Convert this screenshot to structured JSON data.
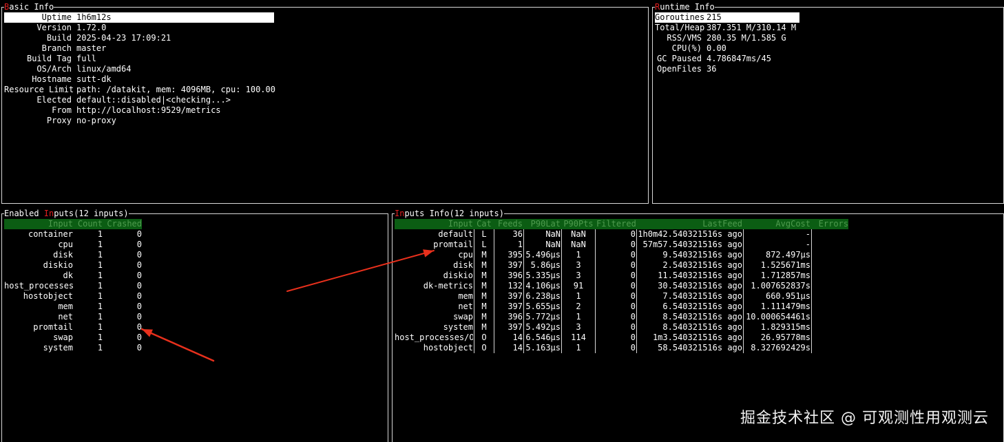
{
  "basic_info": {
    "title_hotkey": "B",
    "title_rest": "asic Info",
    "fields": [
      {
        "key": "Uptime",
        "value": "1h6m12s"
      },
      {
        "key": "Version",
        "value": "1.72.0"
      },
      {
        "key": "Build",
        "value": "2025-04-23 17:09:21"
      },
      {
        "key": "Branch",
        "value": "master"
      },
      {
        "key": "Build Tag",
        "value": "full"
      },
      {
        "key": "OS/Arch",
        "value": "linux/amd64"
      },
      {
        "key": "Hostname",
        "value": "sutt-dk"
      },
      {
        "key": "Resource Limit",
        "value": "path: /datakit, mem: 4096MB, cpu: 100.00"
      },
      {
        "key": "Elected",
        "value": "default::disabled|<checking...>"
      },
      {
        "key": "From",
        "value": "http://localhost:9529/metrics"
      },
      {
        "key": "Proxy",
        "value": "no-proxy"
      }
    ]
  },
  "runtime_info": {
    "title_hotkey": "R",
    "title_rest": "untime Info",
    "fields": [
      {
        "key": "Goroutines",
        "value": "215"
      },
      {
        "key": "Total/Heap",
        "value": "387.351 M/310.14 M"
      },
      {
        "key": "RSS/VMS",
        "value": "280.35 M/1.585 G"
      },
      {
        "key": "CPU(%)",
        "value": "0.00"
      },
      {
        "key": "GC Paused",
        "value": "4.786847ms/45"
      },
      {
        "key": "OpenFiles",
        "value": "36"
      }
    ]
  },
  "enabled_inputs": {
    "title_pre": "Enabled ",
    "title_hotkey": "In",
    "title_rest": "puts(12 inputs)",
    "columns": [
      "Input",
      "Count",
      "Crashed"
    ],
    "rows": [
      [
        "container",
        "1",
        "0"
      ],
      [
        "cpu",
        "1",
        "0"
      ],
      [
        "disk",
        "1",
        "0"
      ],
      [
        "diskio",
        "1",
        "0"
      ],
      [
        "dk",
        "1",
        "0"
      ],
      [
        "host_processes",
        "1",
        "0"
      ],
      [
        "hostobject",
        "1",
        "0"
      ],
      [
        "mem",
        "1",
        "0"
      ],
      [
        "net",
        "1",
        "0"
      ],
      [
        "promtail",
        "1",
        "0"
      ],
      [
        "swap",
        "1",
        "0"
      ],
      [
        "system",
        "1",
        "0"
      ]
    ]
  },
  "inputs_info": {
    "title_hotkey": "In",
    "title_rest": "puts Info(12 inputs)",
    "columns": [
      "Input",
      "Cat",
      "Feeds",
      "P90Lat",
      "P90Pts",
      "Filtered",
      "LastFeed",
      "AvgCost",
      "Errors"
    ],
    "rows": [
      [
        "default",
        "L",
        "36",
        "NaN",
        "NaN",
        "0",
        "1h0m42.540321516s ago",
        "-",
        ""
      ],
      [
        "promtail",
        "L",
        "1",
        "NaN",
        "NaN",
        "0",
        "57m57.540321516s ago",
        "-",
        ""
      ],
      [
        "cpu",
        "M",
        "395",
        "5.496µs",
        "1",
        "0",
        "9.540321516s ago",
        "872.497µs",
        ""
      ],
      [
        "disk",
        "M",
        "397",
        "5.86µs",
        "3",
        "0",
        "2.540321516s ago",
        "1.525671ms",
        ""
      ],
      [
        "diskio",
        "M",
        "396",
        "5.335µs",
        "3",
        "0",
        "11.540321516s ago",
        "1.712857ms",
        ""
      ],
      [
        "dk-metrics",
        "M",
        "132",
        "4.106µs",
        "91",
        "0",
        "30.540321516s ago",
        "1.007652837s",
        ""
      ],
      [
        "mem",
        "M",
        "397",
        "6.238µs",
        "1",
        "0",
        "7.540321516s ago",
        "660.951µs",
        ""
      ],
      [
        "net",
        "M",
        "397",
        "5.655µs",
        "2",
        "0",
        "6.540321516s ago",
        "1.111479ms",
        ""
      ],
      [
        "swap",
        "M",
        "396",
        "5.772µs",
        "1",
        "0",
        "8.540321516s ago",
        "10.000654461s",
        ""
      ],
      [
        "system",
        "M",
        "397",
        "5.492µs",
        "3",
        "0",
        "8.540321516s ago",
        "1.829315ms",
        ""
      ],
      [
        "host_processes/O",
        "O",
        "14",
        "6.546µs",
        "114",
        "0",
        "1m3.540321516s ago",
        "26.95778ms",
        ""
      ],
      [
        "hostobject",
        "O",
        "14",
        "5.163µs",
        "1",
        "0",
        "58.540321516s ago",
        "8.327692429s",
        ""
      ]
    ]
  },
  "watermark": "掘金技术社区 @ 可观测性用观测云",
  "colors": {
    "annotation_arrow": "#e8301c",
    "header_bg": "#0b5d13",
    "hotkey": "#e02020"
  }
}
